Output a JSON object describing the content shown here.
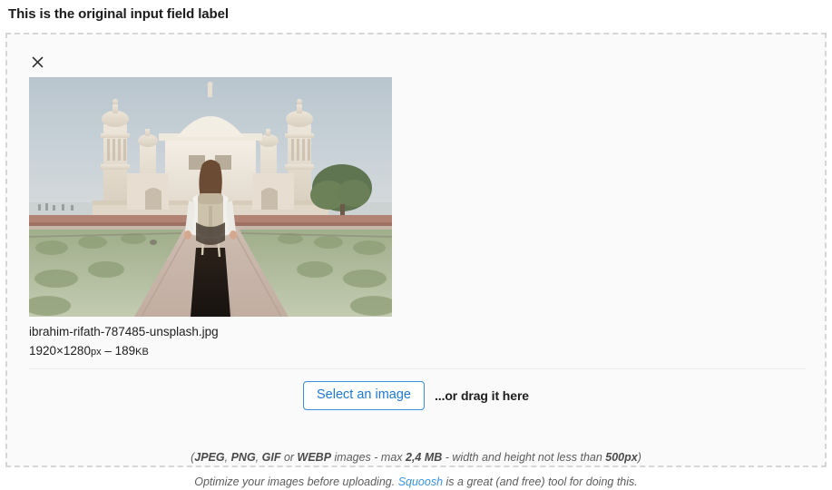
{
  "field_label": "This is the original input field label",
  "preview": {
    "remove_icon": "close-icon",
    "remove_label": "✕",
    "file_name": "ibrahim-rifath-787485-unsplash.jpg",
    "dimensions": "1920×1280",
    "dimensions_unit": "px",
    "separator": "–",
    "file_size_value": "189",
    "file_size_unit": "KB",
    "image_alt": "Woman with backpack walking along garden path toward white marble Mughal mausoleum"
  },
  "actions": {
    "select_button_label": "Select an image",
    "drag_hint": "...or drag it here"
  },
  "help": {
    "line1": {
      "open_paren": "(",
      "format_jpeg": "JPEG",
      "comma1": ", ",
      "format_png": "PNG",
      "comma2": ", ",
      "format_gif": "GIF",
      "or": " or ",
      "format_webp": "WEBP",
      "mid": " images - max ",
      "max_size": "2,4 MB",
      "tail": " - width and height not less than ",
      "min_dimension": "500px",
      "close_paren": ")"
    },
    "line2": {
      "before_link": "Optimize your images before uploading. ",
      "link_label": "Squoosh",
      "after_link": " is a great (and free) tool for doing this."
    }
  },
  "colors": {
    "accent_blue": "#2079d0",
    "link_blue": "#3d93e0",
    "border_dashed": "#d6d6d6",
    "dropzone_bg": "#fafafa",
    "text_dark": "#1d1d1d",
    "help_text": "#5c5c5c"
  }
}
